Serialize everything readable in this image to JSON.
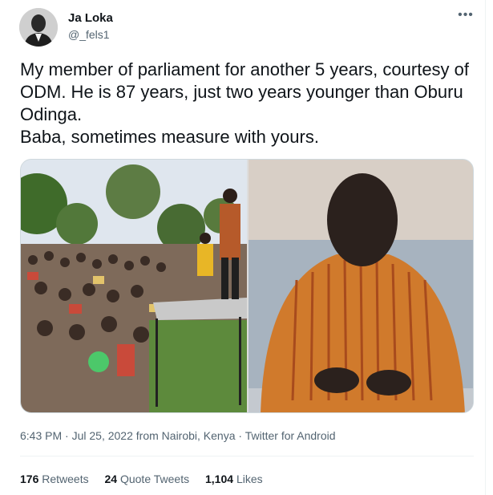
{
  "author": {
    "name": "Ja Loka",
    "handle": "@_fels1"
  },
  "tweet": {
    "text": "My member of parliament for another 5 years, courtesy of ODM.  He is 87 years, just two years younger than Oburu Odinga.\nBaba, sometimes measure with yours."
  },
  "meta": {
    "time": "6:43 PM",
    "sep1": " · ",
    "date": "Jul 25, 2022",
    "location": " from Nairobi, Kenya",
    "sep2": " · ",
    "source": "Twitter for Android"
  },
  "stats": {
    "retweets_count": "176",
    "retweets_label": "Retweets",
    "quotes_count": "24",
    "quotes_label": "Quote Tweets",
    "likes_count": "1,104",
    "likes_label": "Likes"
  },
  "icons": {
    "more": "more-options-icon"
  }
}
